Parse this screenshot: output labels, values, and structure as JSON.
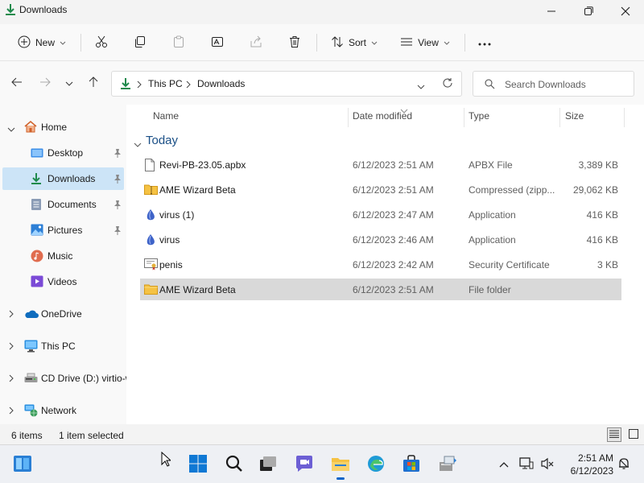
{
  "window": {
    "title": "Downloads",
    "controls": [
      "minimize-icon",
      "maximize-icon",
      "close-icon"
    ]
  },
  "toolbar": {
    "new_label": "New",
    "sort_label": "Sort",
    "view_label": "View",
    "icons": [
      "new-icon",
      "cut-icon",
      "copy-icon",
      "paste-icon",
      "rename-icon",
      "share-icon",
      "delete-icon",
      "sort-icon",
      "view-icon",
      "more-icon"
    ]
  },
  "address": {
    "breadcrumb": [
      "This PC",
      "Downloads"
    ],
    "search_placeholder": "Search Downloads"
  },
  "sidebar": {
    "items": [
      {
        "label": "Home",
        "icon": "home-icon"
      },
      {
        "label": "Desktop",
        "icon": "desktop-icon",
        "pinned": true
      },
      {
        "label": "Downloads",
        "icon": "downloads-icon",
        "pinned": true,
        "selected": true
      },
      {
        "label": "Documents",
        "icon": "documents-icon",
        "pinned": true
      },
      {
        "label": "Pictures",
        "icon": "pictures-icon",
        "pinned": true
      },
      {
        "label": "Music",
        "icon": "music-icon"
      },
      {
        "label": "Videos",
        "icon": "videos-icon"
      },
      {
        "label": "OneDrive",
        "icon": "onedrive-icon"
      },
      {
        "label": "This PC",
        "icon": "this-pc-icon"
      },
      {
        "label": "CD Drive (D:) virtio-w",
        "icon": "cd-drive-icon"
      },
      {
        "label": "Network",
        "icon": "network-icon"
      }
    ]
  },
  "file_list": {
    "columns": [
      "Name",
      "Date modified",
      "Type",
      "Size"
    ],
    "group": "Today",
    "rows": [
      {
        "name": "Revi-PB-23.05.apbx",
        "date": "6/12/2023 2:51 AM",
        "type": "APBX File",
        "size": "3,389 KB",
        "icon": "file-icon"
      },
      {
        "name": "AME Wizard Beta",
        "date": "6/12/2023 2:51 AM",
        "type": "Compressed (zipp...",
        "size": "29,062 KB",
        "icon": "zip-folder-icon"
      },
      {
        "name": "virus (1)",
        "date": "6/12/2023 2:47 AM",
        "type": "Application",
        "size": "416 KB",
        "icon": "application-icon"
      },
      {
        "name": "virus",
        "date": "6/12/2023 2:46 AM",
        "type": "Application",
        "size": "416 KB",
        "icon": "application-icon"
      },
      {
        "name": "penis",
        "date": "6/12/2023 2:42 AM",
        "type": "Security Certificate",
        "size": "3 KB",
        "icon": "certificate-icon"
      },
      {
        "name": "AME Wizard Beta",
        "date": "6/12/2023 2:51 AM",
        "type": "File folder",
        "size": "",
        "icon": "folder-icon",
        "selected": true
      }
    ]
  },
  "status": {
    "item_count": "6 items",
    "selection": "1 item selected"
  },
  "taskbar": {
    "time": "2:51 AM",
    "date": "6/12/2023"
  },
  "colors": {
    "accent": "#0a64c8",
    "selected_nav": "#cce4f7",
    "selected_row": "#d9d9d9",
    "group_header": "#1a4f86",
    "folder": "#f5c243"
  }
}
